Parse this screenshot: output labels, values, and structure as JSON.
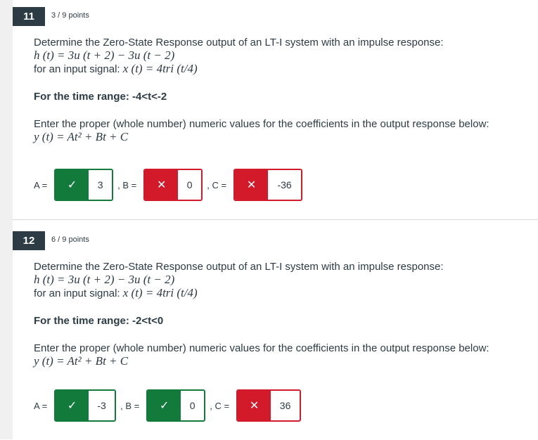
{
  "questions": [
    {
      "number": "11",
      "points": "3 / 9 points",
      "prompt": "Determine the Zero-State Response output of an LT-I system with an impulse response:",
      "impulse": "h (t) = 3u (t + 2) − 3u (t − 2)",
      "input_label": "for an input signal: ",
      "input_math": "x (t) = 4tri (t/4)",
      "range": "For the time range: -4<t<-2",
      "instructions": "Enter the proper (whole number) numeric values for the coefficients in the output response below:",
      "output_math": "y (t) = At² + Bt + C",
      "answers": [
        {
          "label": "A =",
          "value": "3",
          "status": "correct",
          "mark": "✓"
        },
        {
          "label": ", B =",
          "value": "0",
          "status": "incorrect",
          "mark": "✕"
        },
        {
          "label": ", C =",
          "value": "-36",
          "status": "incorrect",
          "mark": "✕"
        }
      ]
    },
    {
      "number": "12",
      "points": "6 / 9 points",
      "prompt": "Determine the Zero-State Response output of an LT-I system with an impulse response:",
      "impulse": "h (t) = 3u (t + 2) − 3u (t − 2)",
      "input_label": "for an input signal: ",
      "input_math": "x (t) = 4tri (t/4)",
      "range": "For the time range: -2<t<0",
      "instructions": "Enter the proper (whole number) numeric values for the coefficients in the output response below:",
      "output_math": "y (t) = At² + Bt + C",
      "answers": [
        {
          "label": "A =",
          "value": "-3",
          "status": "correct",
          "mark": "✓"
        },
        {
          "label": ", B =",
          "value": "0",
          "status": "correct",
          "mark": "✓"
        },
        {
          "label": ", C =",
          "value": "36",
          "status": "incorrect",
          "mark": "✕"
        }
      ]
    }
  ],
  "colors": {
    "correct": "#127a3b",
    "incorrect": "#d21a2b",
    "badge": "#2d3b45"
  }
}
